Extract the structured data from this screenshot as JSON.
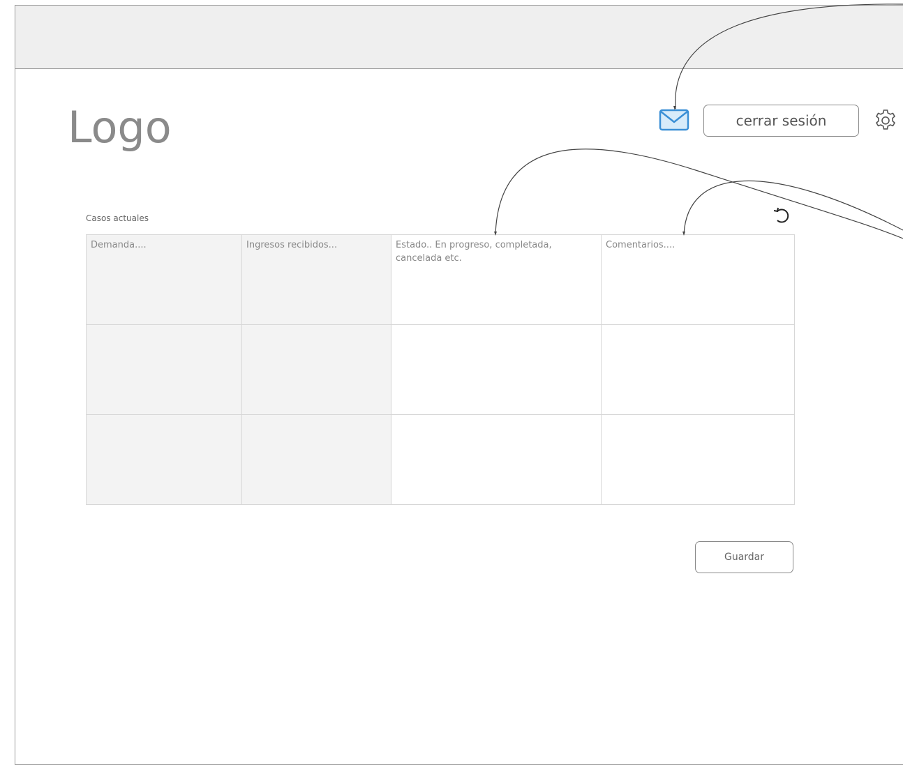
{
  "logo": "Logo",
  "header": {
    "logout_label": "cerrar sesión",
    "icons": [
      "mail-icon",
      "gear-icon"
    ]
  },
  "main": {
    "section_label": "Casos actuales",
    "table": {
      "rows": [
        [
          "Demanda....",
          "Ingresos recibidos...",
          "Estado.. En progreso, completada, cancelada etc.",
          "Comentarios...."
        ],
        [
          "",
          "",
          "",
          ""
        ],
        [
          "",
          "",
          "",
          ""
        ]
      ]
    },
    "save_label": "Guardar",
    "refresh_icon": "refresh-icon"
  },
  "colors": {
    "mail_icon": "#3a8fd6",
    "border": "#9a9a9a",
    "topbar": "#efefef",
    "cell_shade": "#f3f3f3"
  }
}
